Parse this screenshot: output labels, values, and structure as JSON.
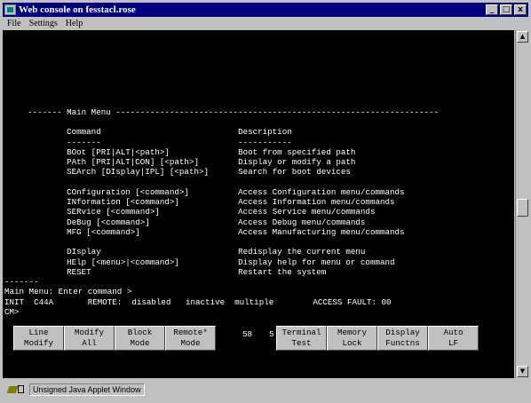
{
  "window": {
    "title": "Web console on fesstacl.rose",
    "min_label": "_",
    "max_label": "□",
    "close_label": "x"
  },
  "menubar": {
    "items": [
      "File",
      "Settings",
      "Help"
    ]
  },
  "console_lines": [
    {
      "row": 0,
      "col": 0,
      "text": ""
    },
    {
      "row": 1,
      "col": 0,
      "text": ""
    },
    {
      "row": 2,
      "col": 0,
      "text": ""
    },
    {
      "row": 3,
      "col": 0,
      "text": ""
    },
    {
      "row": 4,
      "col": 0,
      "text": ""
    },
    {
      "row": 5,
      "col": 0,
      "text": ""
    },
    {
      "row": 6,
      "col": 0,
      "text": ""
    },
    {
      "row": 7,
      "col": 0,
      "text": "------- Main Menu ------------------------------------------------------------------"
    },
    {
      "row": 9,
      "col": 0,
      "text": "        Command                            Description"
    },
    {
      "row": 10,
      "col": 0,
      "text": "        -------                            -----------"
    },
    {
      "row": 11,
      "col": 0,
      "text": "        BOot [PRI|ALT|<path>]              Boot from specified path"
    },
    {
      "row": 12,
      "col": 0,
      "text": "        PAth [PRI|ALT|CON] [<path>]        Display or modify a path"
    },
    {
      "row": 13,
      "col": 0,
      "text": "        SEArch [DIsplay|IPL] [<path>]      Search for boot devices"
    },
    {
      "row": 15,
      "col": 0,
      "text": "        COnfiguration [<command>]          Access Configuration menu/commands"
    },
    {
      "row": 16,
      "col": 0,
      "text": "        INformation [<command>]            Access Information menu/commands"
    },
    {
      "row": 17,
      "col": 0,
      "text": "        SERvice [<command>]                Access Service menu/commands"
    },
    {
      "row": 18,
      "col": 0,
      "text": "        DeBug [<command>]                  Access Debug menu/commands"
    },
    {
      "row": 19,
      "col": 0,
      "text": "        MFG [<command>]                    Access Manufacturing menu/commands"
    },
    {
      "row": 21,
      "col": 0,
      "text": "        DIsplay                            Redisplay the current menu"
    },
    {
      "row": 22,
      "col": 0,
      "text": "        HElp [<menu>|<command>]            Display help for menu or command"
    },
    {
      "row": 23,
      "col": 0,
      "text": "        RESET                              Restart the system"
    },
    {
      "row": 24,
      "col": 0,
      "text": "-------"
    },
    {
      "row": 25,
      "col": 0,
      "text": "Main Menu: Enter command >"
    },
    {
      "row": 26,
      "col": 0,
      "text": "INIT  C44A       REMOTE:  disabled   inactive  multiple        ACCESS FAULT: 00"
    },
    {
      "row": 27,
      "col": 0,
      "text": "CM>"
    }
  ],
  "fkeys": [
    {
      "line1": "Line",
      "line2": "Modify"
    },
    {
      "line1": "Modify",
      "line2": "All"
    },
    {
      "line1": "Block",
      "line2": "Mode"
    },
    {
      "line1": "Remote*",
      "line2": "Mode"
    },
    {
      "line1": "Terminal",
      "line2": "Test"
    },
    {
      "line1": "Memory",
      "line2": "Lock"
    },
    {
      "line1": "Display",
      "line2": "Functns"
    },
    {
      "line1": "Auto",
      "line2": "LF"
    }
  ],
  "cursor_pos": {
    "row": "58",
    "col": "5"
  },
  "scrollbar": {
    "up": "▲",
    "down": "▼"
  },
  "statusbar": {
    "icon": "key-icon",
    "text": "Unsigned Java Applet Window"
  },
  "colors": {
    "title_bg": "#000080",
    "console_bg": "#000000",
    "console_fg": "#ffffff",
    "chrome": "#c0c0c0"
  }
}
